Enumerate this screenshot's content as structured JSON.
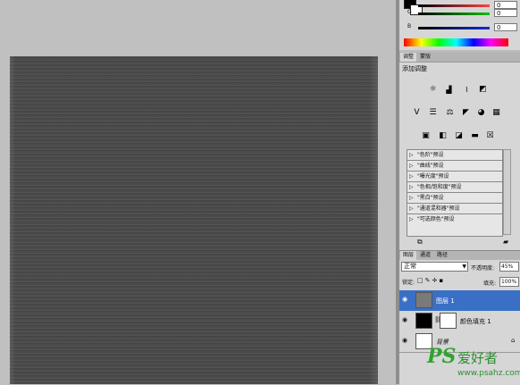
{
  "color_panel": {
    "fg_color": "#000000",
    "bg_color": "#ffffff",
    "channels": [
      {
        "label": "",
        "value": "0",
        "color": "#ff4444"
      },
      {
        "label": "G",
        "value": "0",
        "color": "#10c010"
      },
      {
        "label": "B",
        "value": "0",
        "color": "#1030d0"
      }
    ]
  },
  "adjustments": {
    "tabs": [
      "调整",
      "蒙版"
    ],
    "title": "添加调整",
    "icon_rows": [
      [
        "sun-icon",
        "levels-icon",
        "curves-icon",
        "exposure-icon"
      ],
      [
        "vibrance-icon",
        "hue-saturation-icon",
        "color-balance-icon",
        "black-white-icon",
        "photo-filter-icon",
        "channel-mixer-icon"
      ],
      [
        "invert-icon",
        "posterize-icon",
        "threshold-icon",
        "gradient-map-icon",
        "selective-color-icon"
      ]
    ],
    "presets": [
      "\"色阶\"预设",
      "\"曲线\"预设",
      "\"曝光度\"预设",
      "\"色相/饱和度\"预设",
      "\"黑白\"预设",
      "\"通道混和器\"预设",
      "\"可选颜色\"预设"
    ]
  },
  "layers": {
    "tabs": [
      "图层",
      "通道",
      "路径"
    ],
    "blend_mode": "正常",
    "opacity_label": "不透明度:",
    "opacity": "45%",
    "lock_label": "锁定:",
    "fill_label": "填充:",
    "fill": "100%",
    "items": [
      {
        "name": "图层 1",
        "selected": true
      },
      {
        "name": "颜色填充 1",
        "selected": false
      },
      {
        "name": "背景",
        "selected": false
      }
    ]
  },
  "watermark": {
    "ps": "PS",
    "cn": "爱好者",
    "url": "www.psahz.com"
  }
}
